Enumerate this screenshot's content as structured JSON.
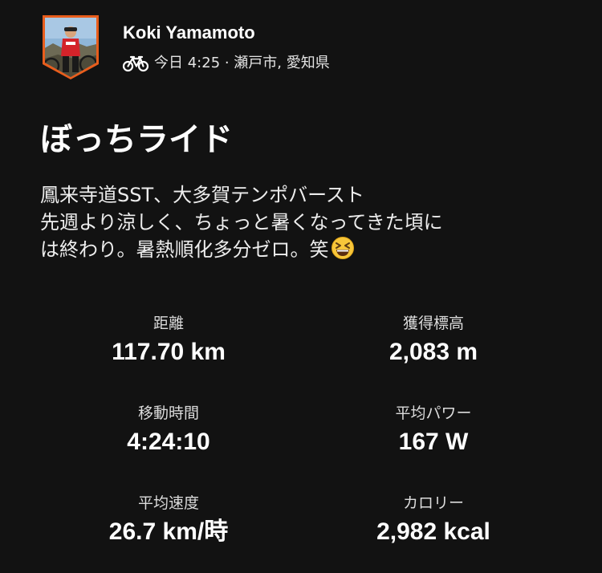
{
  "athlete": {
    "name": "Koki Yamamoto",
    "avatar_icon": "athlete-avatar-photo",
    "badge_color": "#e85d1c"
  },
  "activity": {
    "type_icon": "bicycle-icon",
    "meta": "今日 4:25 · 瀬戸市, 愛知県",
    "title": "ぼっちライド",
    "description_lines": [
      "鳳来寺道SST、大多賀テンポバースト",
      "先週より涼しく、ちょっと暑くなってきた頃に",
      "は終わり。暑熱順化多分ゼロ。笑"
    ],
    "description_emoji": "grinning-squinting-face-emoji"
  },
  "stats": [
    {
      "label": "距離",
      "value": "117.70 km"
    },
    {
      "label": "獲得標高",
      "value": "2,083 m"
    },
    {
      "label": "移動時間",
      "value": "4:24:10"
    },
    {
      "label": "平均パワー",
      "value": "167 W"
    },
    {
      "label": "平均速度",
      "value": "26.7 km/時"
    },
    {
      "label": "カロリー",
      "value": "2,982 kcal"
    }
  ]
}
